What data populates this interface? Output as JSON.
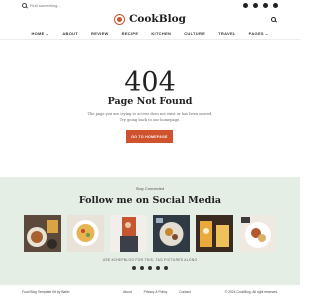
{
  "topbar": {
    "search_placeholder": "Find something...",
    "socials": [
      "facebook-icon",
      "twitter-icon",
      "youtube-icon",
      "pinterest-icon"
    ]
  },
  "header": {
    "logo_text": "CookBlog"
  },
  "nav": {
    "items": [
      {
        "label": "HOME",
        "has_dropdown": true
      },
      {
        "label": "ABOUT",
        "has_dropdown": false
      },
      {
        "label": "REVIEW",
        "has_dropdown": false
      },
      {
        "label": "RECIPE",
        "has_dropdown": false
      },
      {
        "label": "KITCHEN",
        "has_dropdown": false
      },
      {
        "label": "CULTURE",
        "has_dropdown": false
      },
      {
        "label": "TRAVEL",
        "has_dropdown": false
      },
      {
        "label": "PAGES",
        "has_dropdown": true
      }
    ],
    "caret": "⌄"
  },
  "error": {
    "code": "404",
    "title": "Page Not Found",
    "description_line1": "The page you are trying to access does not exist or has been moved.",
    "description_line2": "Try going back to our homepage.",
    "button_label": "GO TO HOMEPAGE",
    "accent": "#d0532f"
  },
  "social": {
    "eyebrow": "Stay Connected",
    "title": "Follow me on Social Media",
    "hashtag": "USE #CHEFBLOG FOR THIS, TAG PICTURES ALONG",
    "band_color": "#e4eee5",
    "icons": [
      "instagram-icon",
      "facebook-icon",
      "twitter-icon",
      "youtube-icon",
      "pinterest-icon"
    ]
  },
  "footer": {
    "left": "Food Blog Template Kit by Bailin",
    "links": [
      "About",
      "Privacy & Policy",
      "Contact"
    ],
    "right": "© 2024 CookBlog. All right reserved."
  }
}
